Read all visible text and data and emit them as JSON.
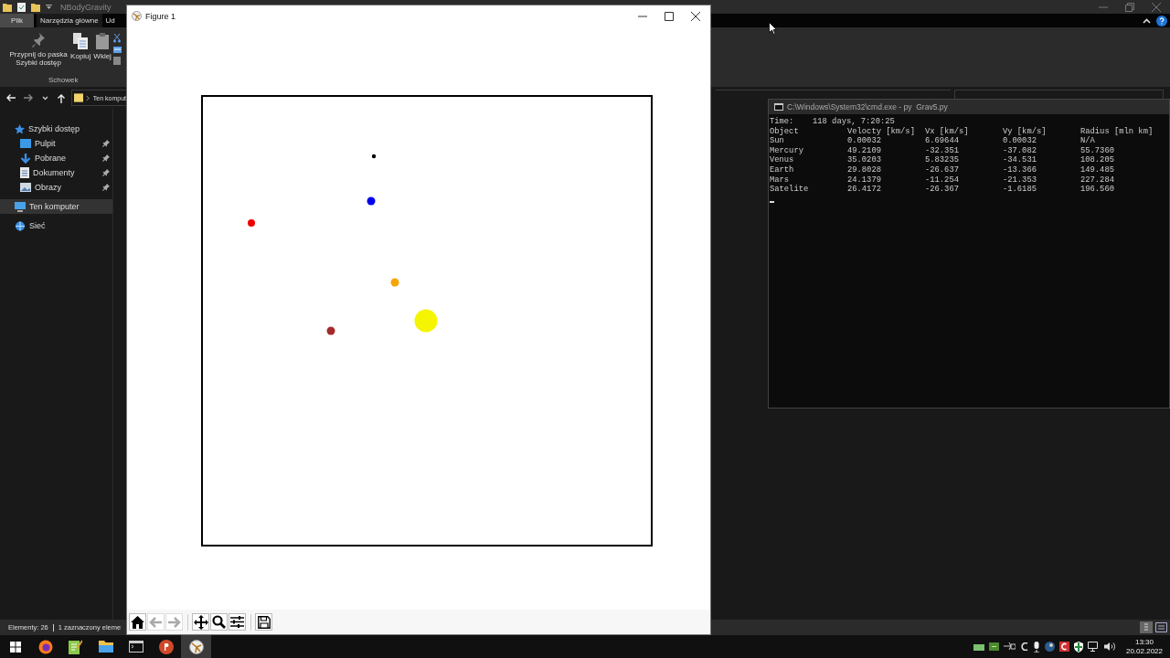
{
  "explorer": {
    "title": "NBodyGravity",
    "ribbon_tabs": [
      {
        "label": "Plik",
        "kind": "file",
        "selected": false
      },
      {
        "label": "Narzędzia główne",
        "kind": "tab",
        "selected": true
      },
      {
        "label": "Ud",
        "kind": "tab",
        "selected": false
      }
    ],
    "ribbon_buttons": [
      {
        "label": "Przypnij do paska Szybki dostęp",
        "kind": "pin"
      },
      {
        "label": "Kopiuj",
        "kind": "copy"
      },
      {
        "label": "Wklej",
        "kind": "paste"
      }
    ],
    "ribbon_group": "Schowek",
    "address": "Ten komput",
    "nav": [
      {
        "label": "Szybki dostęp",
        "kind": "star",
        "selected": false,
        "children": [
          {
            "label": "Pulpit",
            "kind": "desktop",
            "pinned": true,
            "selected": false
          },
          {
            "label": "Pobrane",
            "kind": "download",
            "pinned": true,
            "selected": false
          },
          {
            "label": "Dokumenty",
            "kind": "document",
            "pinned": true,
            "selected": false
          },
          {
            "label": "Obrazy",
            "kind": "image",
            "pinned": true,
            "selected": false
          }
        ]
      },
      {
        "label": "Ten komputer",
        "kind": "pc",
        "selected": true
      },
      {
        "label": "Sieć",
        "kind": "network",
        "selected": false
      }
    ],
    "status": [
      "Elementy: 26",
      "1 zaznaczony eleme"
    ]
  },
  "figure": {
    "title": "Figure 1",
    "toolbar_groups": [
      {
        "buttons": [
          {
            "kind": "home",
            "disabled": false
          },
          {
            "kind": "back",
            "disabled": true
          },
          {
            "kind": "forward",
            "disabled": true
          }
        ]
      },
      {
        "buttons": [
          {
            "kind": "pan",
            "disabled": false
          },
          {
            "kind": "zoom",
            "disabled": false
          },
          {
            "kind": "configure",
            "disabled": false
          }
        ]
      },
      {
        "buttons": [
          {
            "kind": "save",
            "disabled": false
          }
        ]
      }
    ]
  },
  "console": {
    "title": "C:\\Windows\\System32\\cmd.exe - py  Grav5.py",
    "time_label": "Time:",
    "time_value": "118 days, 7:20:25",
    "columns": [
      "Object",
      "Velocty [km/s]",
      "Vx [km/s]",
      "Vy [km/s]",
      "Radius [mln km]"
    ],
    "rows": [
      [
        "Sun",
        "0.00032",
        "6.69644",
        "0.00032",
        "N/A"
      ],
      [
        "Mercury",
        "49.2109",
        "-32.351",
        "-37.082",
        "55.7360"
      ],
      [
        "Venus",
        "35.0203",
        "5.83235",
        "-34.531",
        "108.205"
      ],
      [
        "Earth",
        "29.8028",
        "-26.637",
        "-13.366",
        "149.485"
      ],
      [
        "Mars",
        "24.1379",
        "-11.254",
        "-21.353",
        "227.284"
      ],
      [
        "Satelite",
        "26.4172",
        "-26.367",
        "-1.6185",
        "196.560"
      ]
    ]
  },
  "taskbar": {
    "apps": [
      {
        "kind": "firefox",
        "selected": false
      },
      {
        "kind": "notepad",
        "selected": false
      },
      {
        "kind": "folder",
        "selected": false
      },
      {
        "kind": "terminal",
        "selected": false
      },
      {
        "kind": "powerpoint",
        "selected": false
      },
      {
        "kind": "figure",
        "selected": true
      }
    ],
    "time": "13:30",
    "date": "20.02.2022"
  }
}
